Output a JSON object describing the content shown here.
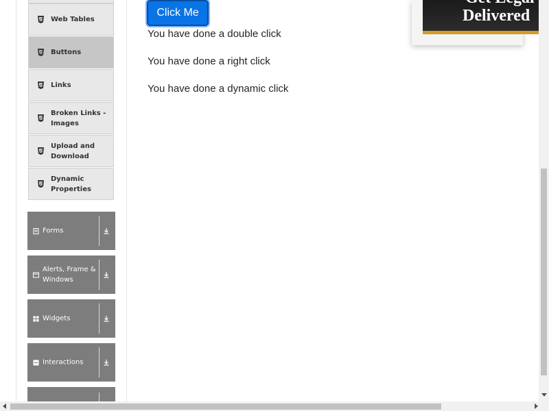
{
  "main": {
    "click_button": "Click Me",
    "messages": [
      "You have done a double click",
      "You have done a right click",
      "You have done a dynamic click"
    ]
  },
  "sidebar": {
    "sub_items": [
      {
        "label": "Web Tables"
      },
      {
        "label": "Buttons"
      },
      {
        "label": "Links"
      },
      {
        "label": "Broken Links -\nImages"
      },
      {
        "label": "Upload and\nDownload"
      },
      {
        "label": "Dynamic\nProperties"
      }
    ],
    "groups": [
      {
        "label": "Forms",
        "icon": "document-icon"
      },
      {
        "label": "Alerts, Frame &\nWindows",
        "icon": "window-icon"
      },
      {
        "label": "Widgets",
        "icon": "grid-icon"
      },
      {
        "label": "Interactions",
        "icon": "interactions-icon"
      },
      {
        "label": "",
        "icon": "book-icon"
      }
    ]
  },
  "ad": {
    "line1": "Get Legal",
    "line2": "Delivered"
  },
  "colors": {
    "accent": "#0a74e6",
    "sidebar_group": "#7d7d7d",
    "sidebar_item": "#e8e8e8",
    "sidebar_item_active": "#c6c6c6"
  }
}
